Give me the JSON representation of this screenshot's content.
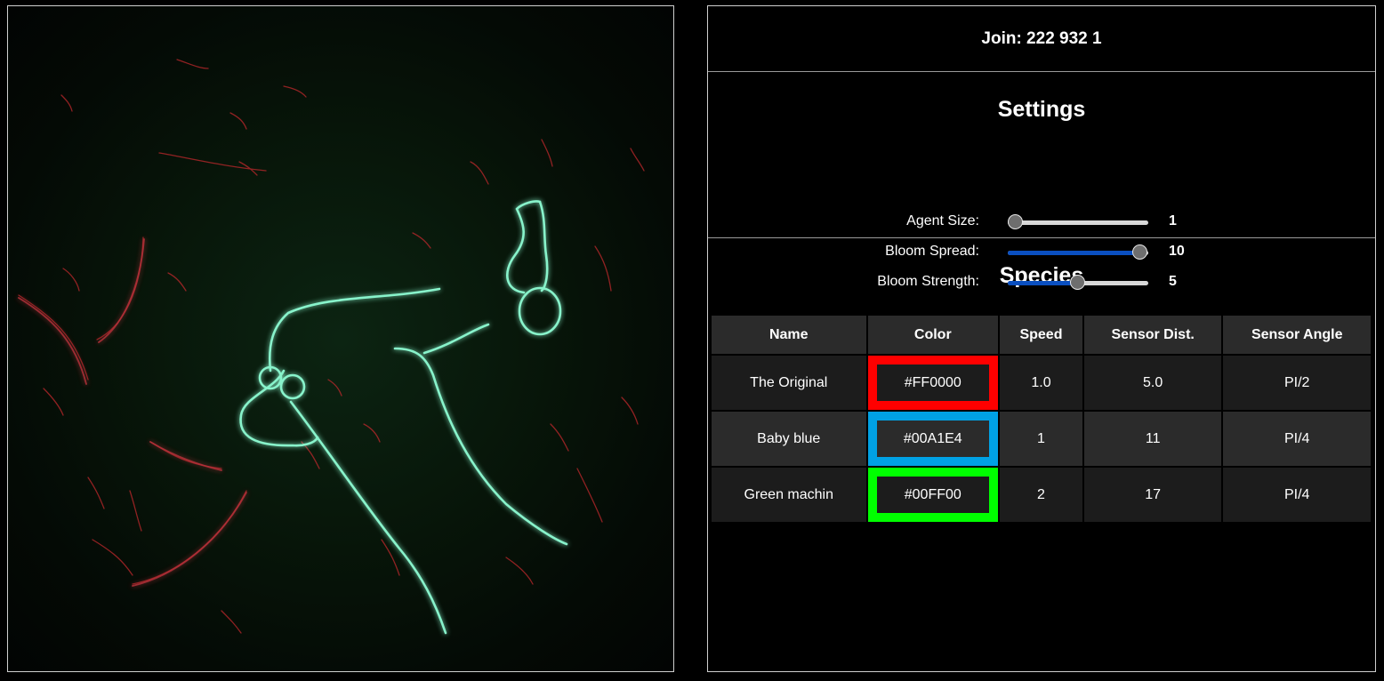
{
  "join": {
    "label": "Join: 222 932 1"
  },
  "settings": {
    "title": "Settings",
    "agent_size": {
      "label": "Agent Size:",
      "value": "1",
      "fraction": 0.0
    },
    "bloom_spread": {
      "label": "Bloom Spread:",
      "value": "10",
      "fraction": 1.0
    },
    "bloom_strength": {
      "label": "Bloom Strength:",
      "value": "5",
      "fraction": 0.5
    }
  },
  "species": {
    "title": "Species",
    "headers": {
      "name": "Name",
      "color": "Color",
      "speed": "Speed",
      "sensor_dist": "Sensor Dist.",
      "sensor_angle": "Sensor Angle"
    },
    "rows": [
      {
        "name": "The Original",
        "color": "#FF0000",
        "speed": "1.0",
        "sensor_dist": "5.0",
        "sensor_angle": "PI/2"
      },
      {
        "name": "Baby blue",
        "color": "#00A1E4",
        "speed": "1",
        "sensor_dist": "11",
        "sensor_angle": "PI/4"
      },
      {
        "name": "Green machin",
        "color": "#00FF00",
        "speed": "2",
        "sensor_dist": "17",
        "sensor_angle": "PI/4"
      }
    ]
  },
  "colors": {
    "panel_border": "#cfcfcf",
    "slider_fill": "#0a4fc0",
    "slider_track": "#d8d8d8",
    "slider_thumb": "#6e6e6e",
    "sim_trail": "#7dffd0"
  }
}
